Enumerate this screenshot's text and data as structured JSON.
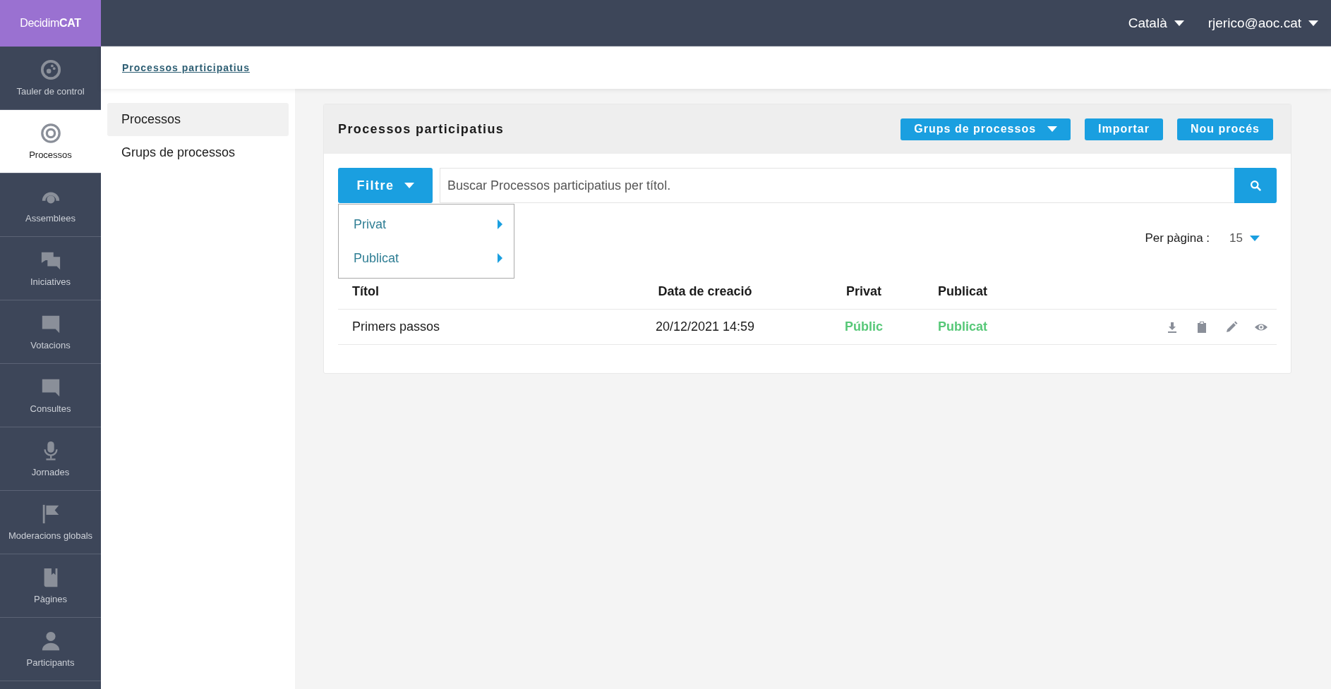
{
  "brand": {
    "name": "Decidim",
    "suffix": "CAT"
  },
  "topbar": {
    "language": "Català",
    "user": "rjerico@aoc.cat"
  },
  "sidebar": {
    "items": [
      {
        "label": "Tauler de control",
        "selected": false
      },
      {
        "label": "Processos",
        "selected": true
      },
      {
        "label": "Assemblees",
        "selected": false
      },
      {
        "label": "Iniciatives",
        "selected": false
      },
      {
        "label": "Votacions",
        "selected": false
      },
      {
        "label": "Consultes",
        "selected": false
      },
      {
        "label": "Jornades",
        "selected": false
      },
      {
        "label": "Moderacions globals",
        "selected": false
      },
      {
        "label": "Pàgines",
        "selected": false
      },
      {
        "label": "Participants",
        "selected": false
      }
    ]
  },
  "breadcrumb": "Processos participatius",
  "secondary_nav": {
    "items": [
      {
        "label": "Processos",
        "selected": true
      },
      {
        "label": "Grups de processos",
        "selected": false
      }
    ]
  },
  "panel": {
    "title": "Processos participatius",
    "buttons": [
      {
        "label": "Grups de processos",
        "dropdown": true
      },
      {
        "label": "Importar",
        "dropdown": false
      },
      {
        "label": "Nou procés",
        "dropdown": false
      }
    ],
    "filter": {
      "label": "Filtre",
      "menu": [
        "Privat",
        "Publicat"
      ]
    },
    "search": {
      "placeholder": "Buscar Processos participatius per títol."
    },
    "per_page": {
      "label": "Per pàgina :",
      "value": "15"
    },
    "table": {
      "columns": [
        "Títol",
        "Data de creació",
        "Privat",
        "Publicat"
      ],
      "rows": [
        {
          "title": "Primers passos",
          "created": "20/12/2021 14:59",
          "private": "Públic",
          "published": "Publicat"
        }
      ]
    }
  }
}
